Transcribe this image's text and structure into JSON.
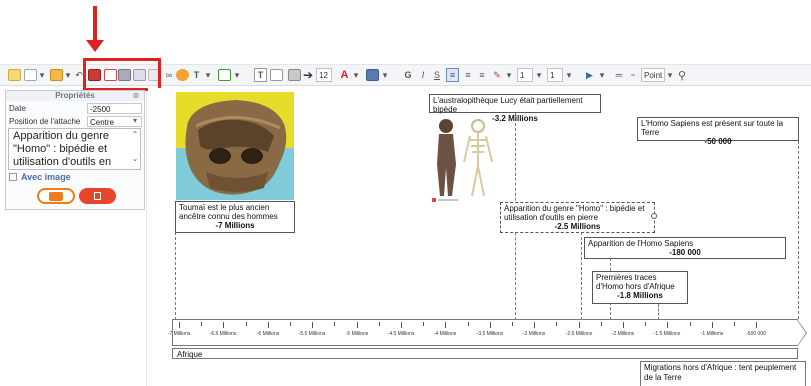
{
  "toolbar": {
    "font_size": "12",
    "line_width": "1",
    "line_style": "1",
    "point_label": "Point"
  },
  "panel": {
    "title": "Propriétés",
    "date_label": "Date",
    "date_value": "-2500",
    "attach_label": "Position de l'attache",
    "attach_value": "Centre",
    "description": "Apparition du genre \"Homo\" : bipédie et utilisation d'outils en pierre",
    "avec_image": "Avec image"
  },
  "events": [
    {
      "text": "Toumaï est le plus ancien ancêtre connu des hommes",
      "value": "-7 Millions"
    },
    {
      "text": "L'australopithèque Lucy était partiellement bipède",
      "value": "-3.2 Millions"
    },
    {
      "text": "L'Homo Sapiens est présent sur toute la Terre",
      "value": "-50 000"
    },
    {
      "text": "Apparition du genre \"Homo\" : bipédie et utilisation d'outils en pierre",
      "value": "-2.5 Millions"
    },
    {
      "text": "Apparition de l'Homo Sapiens",
      "value": "-180 000"
    },
    {
      "text": "Premières traces d'Homo hors d'Afrique",
      "value": "-1.8 Millions"
    }
  ],
  "axis_ticks": [
    "-7 Millions",
    "-6.5 Millions",
    "-6 Millions",
    "-5.5 Millions",
    "-5 Millions",
    "-4.5 Millions",
    "-4 Millions",
    "-3.5 Millions",
    "-3 Millions",
    "-2.5 Millions",
    "-2 Millions",
    "-1.5 Millions",
    "-1 Millions",
    "-500 000"
  ],
  "periods": {
    "afrique": "Afrique",
    "migrations": "Migrations hors d'Afrique : tent peuplement de la Terre"
  },
  "colors": {
    "accent_red": "#e0211d",
    "ok_orange": "#f07a1c",
    "delete_red": "#e8462a",
    "image_yellow": "#e6dd2a",
    "image_cyan": "#7fcbd9"
  }
}
